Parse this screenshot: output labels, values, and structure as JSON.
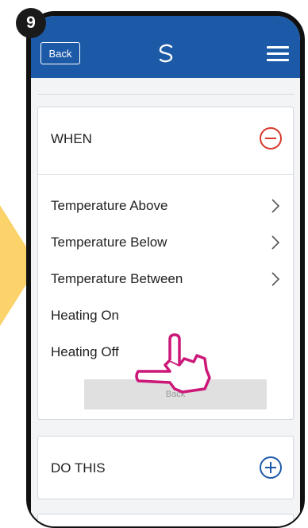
{
  "step_number": "9",
  "header": {
    "back_label": "Back"
  },
  "when_card": {
    "title": "WHEN",
    "options": [
      {
        "label": "Temperature Above",
        "has_chevron": true
      },
      {
        "label": "Temperature Below",
        "has_chevron": true
      },
      {
        "label": "Temperature Between",
        "has_chevron": true
      },
      {
        "label": "Heating On",
        "has_chevron": false
      },
      {
        "label": "Heating Off",
        "has_chevron": false
      }
    ],
    "back_button_label": "Back"
  },
  "do_card": {
    "title": "DO THIS"
  },
  "icons": {
    "logo": "salus-logo-icon",
    "menu": "hamburger-menu-icon",
    "collapse": "minus-circle-icon",
    "expand": "plus-circle-icon",
    "chevron": "chevron-right-icon",
    "pointer": "pointing-hand-icon",
    "arrow": "yellow-arrow-icon"
  },
  "colors": {
    "header": "#1c5aa8",
    "accent_red": "#d8392b",
    "accent_blue": "#1c5aa8",
    "arrow": "#fbd36a",
    "hand": "#cc1878"
  }
}
